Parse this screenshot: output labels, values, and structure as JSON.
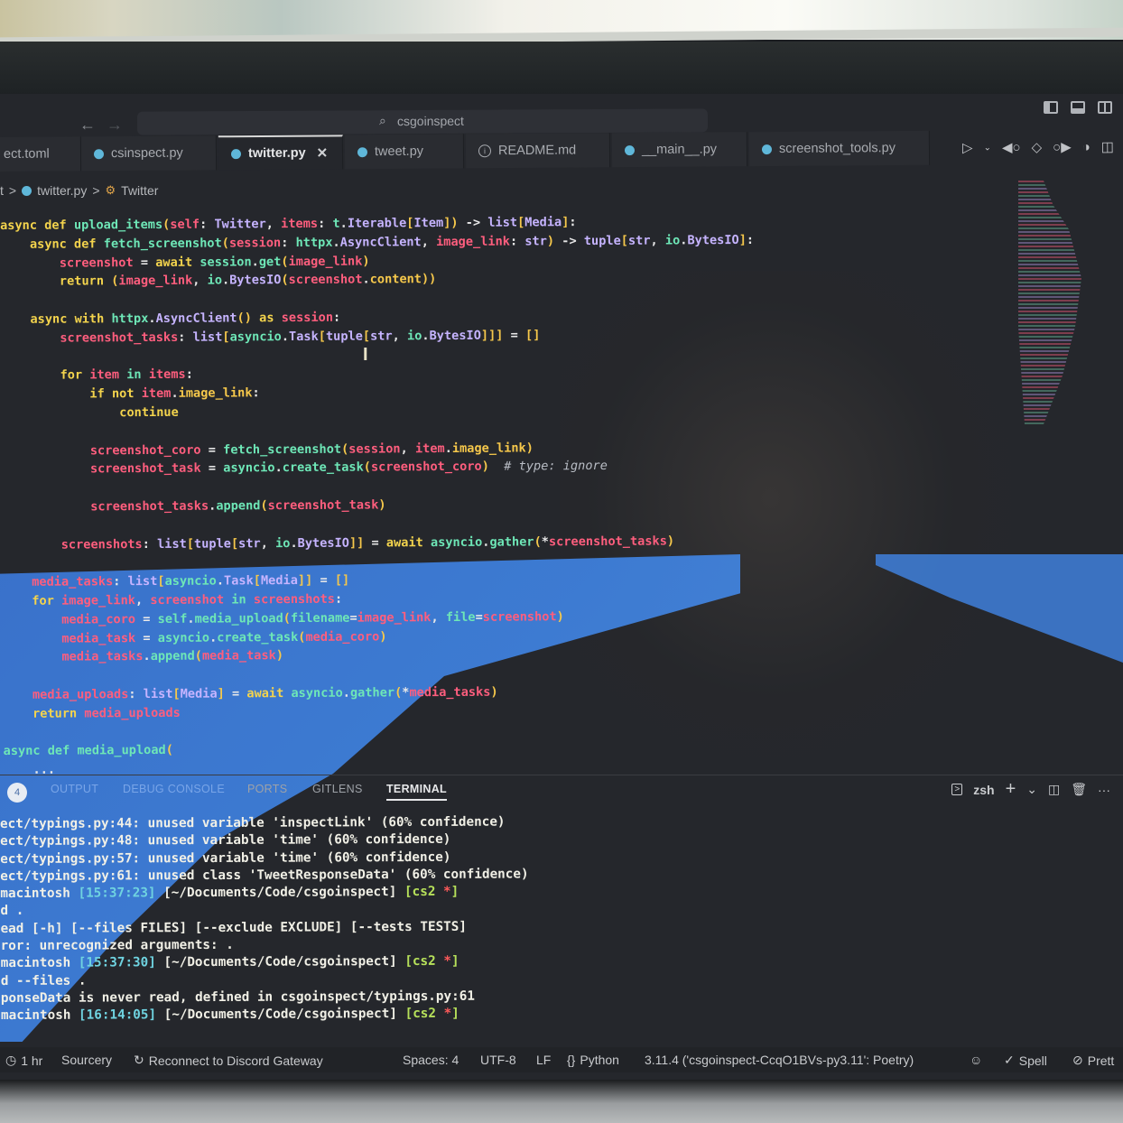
{
  "window": {
    "search_text": "csgoinspect",
    "nav_back": "←",
    "nav_forward": "→"
  },
  "tabs": [
    {
      "label": "ect.toml",
      "icon": "toml-file",
      "active": false
    },
    {
      "label": "csinspect.py",
      "icon": "python-file",
      "active": false
    },
    {
      "label": "twitter.py",
      "icon": "python-file",
      "active": true
    },
    {
      "label": "tweet.py",
      "icon": "python-file",
      "active": false
    },
    {
      "label": "README.md",
      "icon": "info-file",
      "active": false
    },
    {
      "label": "__main__.py",
      "icon": "python-file",
      "active": false
    },
    {
      "label": "screenshot_tools.py",
      "icon": "python-file",
      "active": false
    }
  ],
  "tab_close_glyph": "✕",
  "breadcrumb": {
    "prefix": "t",
    "file": "twitter.py",
    "symbol": "Twitter",
    "separator": ">"
  },
  "editor": {
    "lines": [
      [
        [
          "kw",
          "async "
        ],
        [
          "kw",
          "def "
        ],
        [
          "fn",
          "upload_items"
        ],
        [
          "br",
          "("
        ],
        [
          "var",
          "self"
        ],
        [
          "pu",
          ": "
        ],
        [
          "ty",
          "Twitter"
        ],
        [
          "pu",
          ", "
        ],
        [
          "var",
          "items"
        ],
        [
          "pu",
          ": "
        ],
        [
          "fn",
          "t"
        ],
        [
          "pu",
          "."
        ],
        [
          "ty",
          "Iterable"
        ],
        [
          "br",
          "["
        ],
        [
          "ty",
          "Item"
        ],
        [
          "br",
          "]"
        ],
        [
          "br",
          ")"
        ],
        [
          "pu",
          " -> "
        ],
        [
          "ty",
          "list"
        ],
        [
          "br",
          "["
        ],
        [
          "ty",
          "Media"
        ],
        [
          "br",
          "]"
        ],
        [
          "pu",
          ":"
        ]
      ],
      [
        [
          "kw",
          "    async "
        ],
        [
          "kw",
          "def "
        ],
        [
          "fn",
          "fetch_screenshot"
        ],
        [
          "br",
          "("
        ],
        [
          "var",
          "session"
        ],
        [
          "pu",
          ": "
        ],
        [
          "fn",
          "httpx"
        ],
        [
          "pu",
          "."
        ],
        [
          "ty",
          "AsyncClient"
        ],
        [
          "pu",
          ", "
        ],
        [
          "var",
          "image_link"
        ],
        [
          "pu",
          ": "
        ],
        [
          "ty",
          "str"
        ],
        [
          "br",
          ")"
        ],
        [
          "pu",
          " -> "
        ],
        [
          "ty",
          "tuple"
        ],
        [
          "br",
          "["
        ],
        [
          "ty",
          "str"
        ],
        [
          "pu",
          ", "
        ],
        [
          "fn",
          "io"
        ],
        [
          "pu",
          "."
        ],
        [
          "ty",
          "BytesIO"
        ],
        [
          "br",
          "]"
        ],
        [
          "pu",
          ":"
        ]
      ],
      [
        [
          "var",
          "        screenshot"
        ],
        [
          "pu",
          " = "
        ],
        [
          "kw",
          "await "
        ],
        [
          "fn",
          "session"
        ],
        [
          "pu",
          "."
        ],
        [
          "fn",
          "get"
        ],
        [
          "br",
          "("
        ],
        [
          "var",
          "image_link"
        ],
        [
          "br",
          ")"
        ]
      ],
      [
        [
          "kw",
          "        return "
        ],
        [
          "br",
          "("
        ],
        [
          "var",
          "image_link"
        ],
        [
          "pu",
          ", "
        ],
        [
          "fn",
          "io"
        ],
        [
          "pu",
          "."
        ],
        [
          "ty",
          "BytesIO"
        ],
        [
          "br",
          "("
        ],
        [
          "var",
          "screenshot"
        ],
        [
          "pu",
          "."
        ],
        [
          "br",
          "content"
        ],
        [
          "br",
          "))"
        ]
      ],
      [],
      [
        [
          "kw",
          "    async "
        ],
        [
          "kw",
          "with "
        ],
        [
          "fn",
          "httpx"
        ],
        [
          "pu",
          "."
        ],
        [
          "ty",
          "AsyncClient"
        ],
        [
          "br",
          "()"
        ],
        [
          "kw",
          " as "
        ],
        [
          "var",
          "session"
        ],
        [
          "pu",
          ":"
        ]
      ],
      [
        [
          "var",
          "        screenshot_tasks"
        ],
        [
          "pu",
          ": "
        ],
        [
          "ty",
          "list"
        ],
        [
          "br",
          "["
        ],
        [
          "fn",
          "asyncio"
        ],
        [
          "pu",
          "."
        ],
        [
          "ty",
          "Task"
        ],
        [
          "br",
          "["
        ],
        [
          "ty",
          "tuple"
        ],
        [
          "br",
          "["
        ],
        [
          "ty",
          "str"
        ],
        [
          "pu",
          ", "
        ],
        [
          "fn",
          "io"
        ],
        [
          "pu",
          "."
        ],
        [
          "ty",
          "BytesIO"
        ],
        [
          "br",
          "]]]"
        ],
        [
          "pu",
          " = "
        ],
        [
          "br",
          "[]"
        ]
      ],
      [],
      [
        [
          "kw",
          "        for "
        ],
        [
          "var",
          "item"
        ],
        [
          "fn",
          " in "
        ],
        [
          "var",
          "items"
        ],
        [
          "pu",
          ":"
        ]
      ],
      [
        [
          "kw",
          "            if not "
        ],
        [
          "var",
          "item"
        ],
        [
          "pu",
          "."
        ],
        [
          "br",
          "image_link"
        ],
        [
          "pu",
          ":"
        ]
      ],
      [
        [
          "kw",
          "                continue"
        ]
      ],
      [],
      [
        [
          "var",
          "            screenshot_coro"
        ],
        [
          "pu",
          " = "
        ],
        [
          "fn",
          "fetch_screenshot"
        ],
        [
          "br",
          "("
        ],
        [
          "var",
          "session"
        ],
        [
          "pu",
          ", "
        ],
        [
          "var",
          "item"
        ],
        [
          "pu",
          "."
        ],
        [
          "br",
          "image_link"
        ],
        [
          "br",
          ")"
        ]
      ],
      [
        [
          "var",
          "            screenshot_task"
        ],
        [
          "pu",
          " = "
        ],
        [
          "fn",
          "asyncio"
        ],
        [
          "pu",
          "."
        ],
        [
          "fn",
          "create_task"
        ],
        [
          "br",
          "("
        ],
        [
          "var",
          "screenshot_coro"
        ],
        [
          "br",
          ")"
        ],
        [
          "cm",
          "  # type: ignore"
        ]
      ],
      [],
      [
        [
          "var",
          "            screenshot_tasks"
        ],
        [
          "pu",
          "."
        ],
        [
          "fn",
          "append"
        ],
        [
          "br",
          "("
        ],
        [
          "var",
          "screenshot_task"
        ],
        [
          "br",
          ")"
        ]
      ],
      [],
      [
        [
          "var",
          "        screenshots"
        ],
        [
          "pu",
          ": "
        ],
        [
          "ty",
          "list"
        ],
        [
          "br",
          "["
        ],
        [
          "ty",
          "tuple"
        ],
        [
          "br",
          "["
        ],
        [
          "ty",
          "str"
        ],
        [
          "pu",
          ", "
        ],
        [
          "fn",
          "io"
        ],
        [
          "pu",
          "."
        ],
        [
          "ty",
          "BytesIO"
        ],
        [
          "br",
          "]]"
        ],
        [
          "pu",
          " = "
        ],
        [
          "kw",
          "await "
        ],
        [
          "fn",
          "asyncio"
        ],
        [
          "pu",
          "."
        ],
        [
          "fn",
          "gather"
        ],
        [
          "br",
          "("
        ],
        [
          "pu",
          "*"
        ],
        [
          "var",
          "screenshot_tasks"
        ],
        [
          "br",
          ")"
        ]
      ],
      [],
      [
        [
          "var",
          "    media_tasks"
        ],
        [
          "pu",
          ": "
        ],
        [
          "ty",
          "list"
        ],
        [
          "br",
          "["
        ],
        [
          "fn",
          "asyncio"
        ],
        [
          "pu",
          "."
        ],
        [
          "ty",
          "Task"
        ],
        [
          "br",
          "["
        ],
        [
          "ty",
          "Media"
        ],
        [
          "br",
          "]]"
        ],
        [
          "pu",
          " = "
        ],
        [
          "br",
          "[]"
        ]
      ],
      [
        [
          "kw",
          "    for "
        ],
        [
          "var",
          "image_link"
        ],
        [
          "pu",
          ", "
        ],
        [
          "var",
          "screenshot"
        ],
        [
          "fn",
          " in "
        ],
        [
          "var",
          "screenshots"
        ],
        [
          "pu",
          ":"
        ]
      ],
      [
        [
          "var",
          "        media_coro"
        ],
        [
          "pu",
          " = "
        ],
        [
          "fn",
          "self"
        ],
        [
          "pu",
          "."
        ],
        [
          "fn",
          "media_upload"
        ],
        [
          "br",
          "("
        ],
        [
          "fn",
          "filename"
        ],
        [
          "pu",
          "="
        ],
        [
          "var",
          "image_link"
        ],
        [
          "pu",
          ", "
        ],
        [
          "fn",
          "file"
        ],
        [
          "pu",
          "="
        ],
        [
          "var",
          "screenshot"
        ],
        [
          "br",
          ")"
        ]
      ],
      [
        [
          "var",
          "        media_task"
        ],
        [
          "pu",
          " = "
        ],
        [
          "fn",
          "asyncio"
        ],
        [
          "pu",
          "."
        ],
        [
          "fn",
          "create_task"
        ],
        [
          "br",
          "("
        ],
        [
          "var",
          "media_coro"
        ],
        [
          "br",
          ")"
        ]
      ],
      [
        [
          "var",
          "        media_tasks"
        ],
        [
          "pu",
          "."
        ],
        [
          "fn",
          "append"
        ],
        [
          "br",
          "("
        ],
        [
          "var",
          "media_task"
        ],
        [
          "br",
          ")"
        ]
      ],
      [],
      [
        [
          "var",
          "    media_uploads"
        ],
        [
          "pu",
          ": "
        ],
        [
          "ty",
          "list"
        ],
        [
          "br",
          "["
        ],
        [
          "ty",
          "Media"
        ],
        [
          "br",
          "]"
        ],
        [
          "pu",
          " = "
        ],
        [
          "kw",
          "await "
        ],
        [
          "fn",
          "asyncio"
        ],
        [
          "pu",
          "."
        ],
        [
          "fn",
          "gather"
        ],
        [
          "br",
          "("
        ],
        [
          "pu",
          "*"
        ],
        [
          "var",
          "media_tasks"
        ],
        [
          "br",
          ")"
        ]
      ],
      [
        [
          "kw",
          "    return "
        ],
        [
          "var",
          "media_uploads"
        ]
      ],
      [],
      [
        [
          "fn",
          "async def "
        ],
        [
          "fn",
          "media_upload"
        ],
        [
          "br",
          "("
        ]
      ],
      [
        [
          "pu",
          "    ..."
        ]
      ]
    ]
  },
  "panel": {
    "badge_count": "4",
    "tabs": [
      "OUTPUT",
      "DEBUG CONSOLE",
      "PORTS",
      "GITLENS",
      "TERMINAL"
    ],
    "active_tab": "TERMINAL",
    "shell": "zsh",
    "actions": {
      "new": "+",
      "dropdown": "⌄",
      "split": "split-terminal",
      "trash": "kill-terminal",
      "more": "···"
    }
  },
  "terminal": {
    "lines": [
      [
        {
          "c": "plain",
          "t": "ect/typings.py:44: unused variable 'inspectLink' (60% confidence)"
        }
      ],
      [
        {
          "c": "plain",
          "t": "ect/typings.py:48: unused variable 'time' (60% confidence)"
        }
      ],
      [
        {
          "c": "plain",
          "t": "ect/typings.py:57: unused variable 'time' (60% confidence)"
        }
      ],
      [
        {
          "c": "plain",
          "t": "ect/typings.py:61: unused class 'TweetResponseData' (60% confidence)"
        }
      ],
      [
        {
          "c": "host",
          "t": "macintosh "
        },
        {
          "c": "time",
          "t": "[15:37:23]"
        },
        {
          "c": "path",
          "t": " [~/Documents/Code/csgoinspect] "
        },
        {
          "c": "branch",
          "t": "[cs2 "
        },
        {
          "c": "star",
          "t": "*"
        },
        {
          "c": "branch",
          "t": "]"
        }
      ],
      [
        {
          "c": "plain",
          "t": "d ."
        }
      ],
      [
        {
          "c": "plain",
          "t": "ead [-h] [--files FILES] [--exclude EXCLUDE] [--tests TESTS]"
        }
      ],
      [
        {
          "c": "plain",
          "t": "ror: unrecognized arguments: ."
        }
      ],
      [
        {
          "c": "host",
          "t": "macintosh "
        },
        {
          "c": "time",
          "t": "[15:37:30]"
        },
        {
          "c": "path",
          "t": " [~/Documents/Code/csgoinspect] "
        },
        {
          "c": "branch",
          "t": "[cs2 "
        },
        {
          "c": "star",
          "t": "*"
        },
        {
          "c": "branch",
          "t": "]"
        }
      ],
      [
        {
          "c": "plain",
          "t": "d --files ."
        }
      ],
      [
        {
          "c": "plain",
          "t": "ponseData is never read, defined in csgoinspect/typings.py:61"
        }
      ],
      [
        {
          "c": "host",
          "t": "macintosh "
        },
        {
          "c": "time",
          "t": "[16:14:05]"
        },
        {
          "c": "path",
          "t": " [~/Documents/Code/csgoinspect] "
        },
        {
          "c": "branch",
          "t": "[cs2 "
        },
        {
          "c": "star",
          "t": "*"
        },
        {
          "c": "branch",
          "t": "]"
        }
      ]
    ]
  },
  "statusbar": {
    "timer": "1 hr",
    "sourcery": "Sourcery",
    "discord": "Reconnect to Discord Gateway",
    "spaces": "Spaces: 4",
    "encoding": "UTF-8",
    "eol": "LF",
    "language": "Python",
    "interpreter": "3.11.4 ('csgoinspect-CcqO1BVs-py3.11': Poetry)",
    "spell": "Spell",
    "prettier": "Prett"
  },
  "colors": {
    "keyword": "#f4d44d",
    "function": "#6ee7b7",
    "variable": "#ff5e7e",
    "type": "#c6b4ff",
    "editor_bg": "#25272c",
    "reflection_blue": "#3f82e0"
  }
}
